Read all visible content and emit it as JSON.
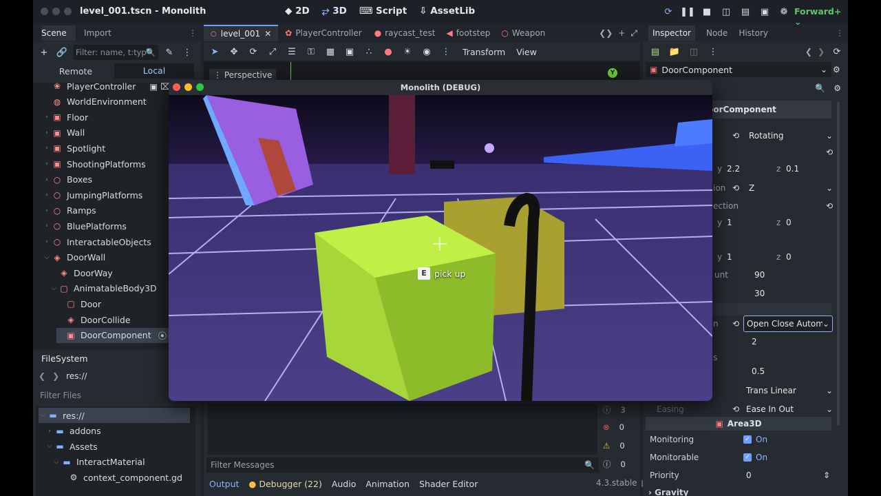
{
  "window": {
    "title": "level_001.tscn - Monolith",
    "renderer": "Forward+"
  },
  "toolbar": {
    "mode_2d": "2D",
    "mode_3d": "3D",
    "script": "Script",
    "assetlib": "AssetLib"
  },
  "scene_dock": {
    "tab_scene": "Scene",
    "tab_import": "Import",
    "filter_placeholder": "Filter: name, t:type,",
    "remote": "Remote",
    "local": "Local",
    "nodes": [
      {
        "label": "PlayerController",
        "icon": "player-icon",
        "color": "#ff8c8c",
        "indent": 1
      },
      {
        "label": "WorldEnvironment",
        "icon": "globe-icon",
        "color": "#ff8c8c",
        "indent": 1
      },
      {
        "label": "Floor",
        "icon": "mesh-icon",
        "color": "#ff8c8c",
        "indent": 1
      },
      {
        "label": "Wall",
        "icon": "mesh-icon",
        "color": "#ff8c8c",
        "indent": 1
      },
      {
        "label": "Spotlight",
        "icon": "mesh-icon",
        "color": "#ff8c8c",
        "indent": 1
      },
      {
        "label": "ShootingPlatforms",
        "icon": "mesh-icon",
        "color": "#ff8c8c",
        "indent": 1
      },
      {
        "label": "Boxes",
        "icon": "node3d-icon",
        "color": "#ff8c8c",
        "indent": 1
      },
      {
        "label": "JumpingPlatforms",
        "icon": "node3d-icon",
        "color": "#ff8c8c",
        "indent": 1
      },
      {
        "label": "Ramps",
        "icon": "node3d-icon",
        "color": "#ff8c8c",
        "indent": 1
      },
      {
        "label": "BluePlatforms",
        "icon": "node3d-icon",
        "color": "#ff8c8c",
        "indent": 1
      },
      {
        "label": "InteractableObjects",
        "icon": "node3d-icon",
        "color": "#ff8c8c",
        "indent": 1
      },
      {
        "label": "DoorWall",
        "icon": "body-icon",
        "color": "#ff8c8c",
        "indent": 1
      },
      {
        "label": "DoorWay",
        "icon": "body-icon",
        "color": "#ff8c8c",
        "indent": 2
      },
      {
        "label": "AnimatableBody3D",
        "icon": "collision-icon",
        "color": "#ff8c8c",
        "indent": 2
      },
      {
        "label": "Door",
        "icon": "collision-icon",
        "color": "#ff8c8c",
        "indent": 3
      },
      {
        "label": "DoorCollide",
        "icon": "body-icon",
        "color": "#ff8c8c",
        "indent": 3
      },
      {
        "label": "DoorComponent",
        "icon": "component-icon",
        "color": "#ff8c8c",
        "indent": 3
      }
    ]
  },
  "filesystem": {
    "title": "FileSystem",
    "path": "res://",
    "filter": "Filter Files",
    "items": [
      {
        "label": "res://",
        "indent": 0
      },
      {
        "label": "addons",
        "indent": 1
      },
      {
        "label": "Assets",
        "indent": 1
      },
      {
        "label": "InteractMaterial",
        "indent": 2
      },
      {
        "label": "context_component.gd",
        "indent": 3
      }
    ]
  },
  "editor_tabs": [
    "level_001",
    "PlayerController",
    "raycast_test",
    "footstep",
    "Weapon"
  ],
  "viewport": {
    "transform": "Transform",
    "view": "View",
    "perspective": "Perspective"
  },
  "game_window": {
    "title": "Monolith (DEBUG)",
    "prompt_key": "E",
    "prompt_text": "pick up"
  },
  "bottom": {
    "filter": "Filter Messages",
    "tabs": [
      "Output",
      "Debugger (22)",
      "Audio",
      "Animation",
      "Shader Editor"
    ],
    "version": "4.3.stable",
    "counts": [
      "3",
      "0",
      "0",
      "0"
    ]
  },
  "inspector": {
    "tab_inspector": "Inspector",
    "tab_node": "Node",
    "tab_history": "History",
    "object": "DoorComponent",
    "section": "DoorComponent",
    "door_type": "Rotating",
    "axis": "Z",
    "y1": "2.2",
    "z1": "0.1",
    "y2": "1",
    "z2": "0",
    "y3": "1",
    "z3": "0",
    "frag_rotation": "ion",
    "frag_direction": "ection",
    "frag_amount": "unt",
    "frag_open": "n",
    "frag_s": "s",
    "v90": "90",
    "v30": "30",
    "open_mode": "Open Close Automa",
    "v2": "2",
    "v05": "0.5",
    "trans": "Trans Linear",
    "easing_label": "Easing",
    "easing": "Ease In Out",
    "area": "Area3D",
    "monitoring": "Monitoring",
    "monitorable": "Monitorable",
    "on": "On",
    "priority": "Priority",
    "priority_val": "0",
    "gravity": "Gravity"
  }
}
